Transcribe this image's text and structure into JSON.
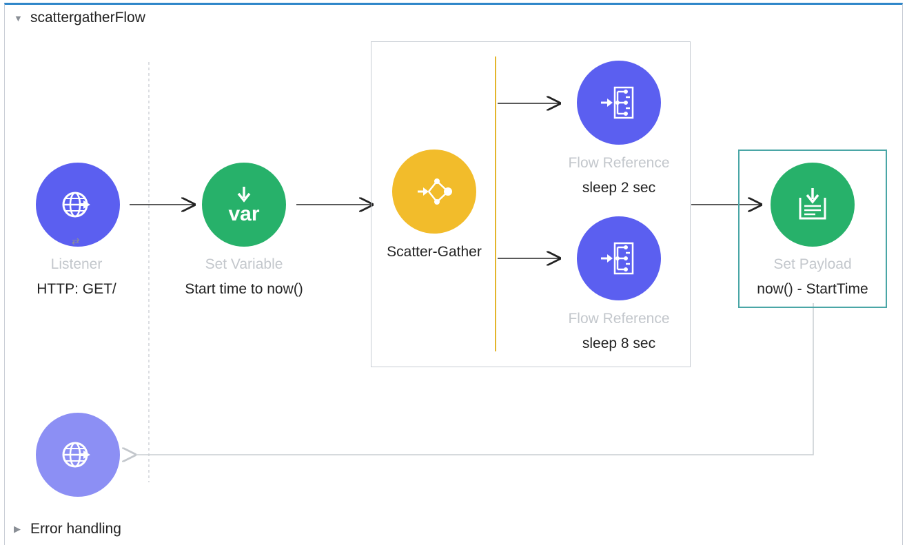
{
  "flow": {
    "name": "scattergatherFlow",
    "expanded_glyph": "▼",
    "error_label": "Error handling",
    "collapsed_glyph": "▶"
  },
  "nodes": {
    "listener": {
      "type": "Listener",
      "name": "HTTP: GET/",
      "icon": "globe-arrow-icon",
      "color": "#5b5ff0"
    },
    "set_variable": {
      "type": "Set Variable",
      "name": "Start time to now()",
      "icon": "var-icon",
      "icon_text": "var",
      "color": "#27b16a"
    },
    "scatter_gather": {
      "name": "Scatter-Gather",
      "icon": "scatter-gather-icon",
      "color": "#f2bc2b"
    },
    "flow_ref_1": {
      "type": "Flow Reference",
      "name": "sleep 2 sec",
      "icon": "flow-reference-icon",
      "color": "#5b5ff0"
    },
    "flow_ref_2": {
      "type": "Flow Reference",
      "name": "sleep 8 sec",
      "icon": "flow-reference-icon",
      "color": "#5b5ff0"
    },
    "set_payload": {
      "type": "Set Payload",
      "name": "now() - StartTime",
      "icon": "set-payload-icon",
      "color": "#27b16a"
    },
    "response": {
      "icon": "globe-arrow-icon",
      "color": "#8c8ff4"
    }
  },
  "source_toggle_glyph": "⇄"
}
